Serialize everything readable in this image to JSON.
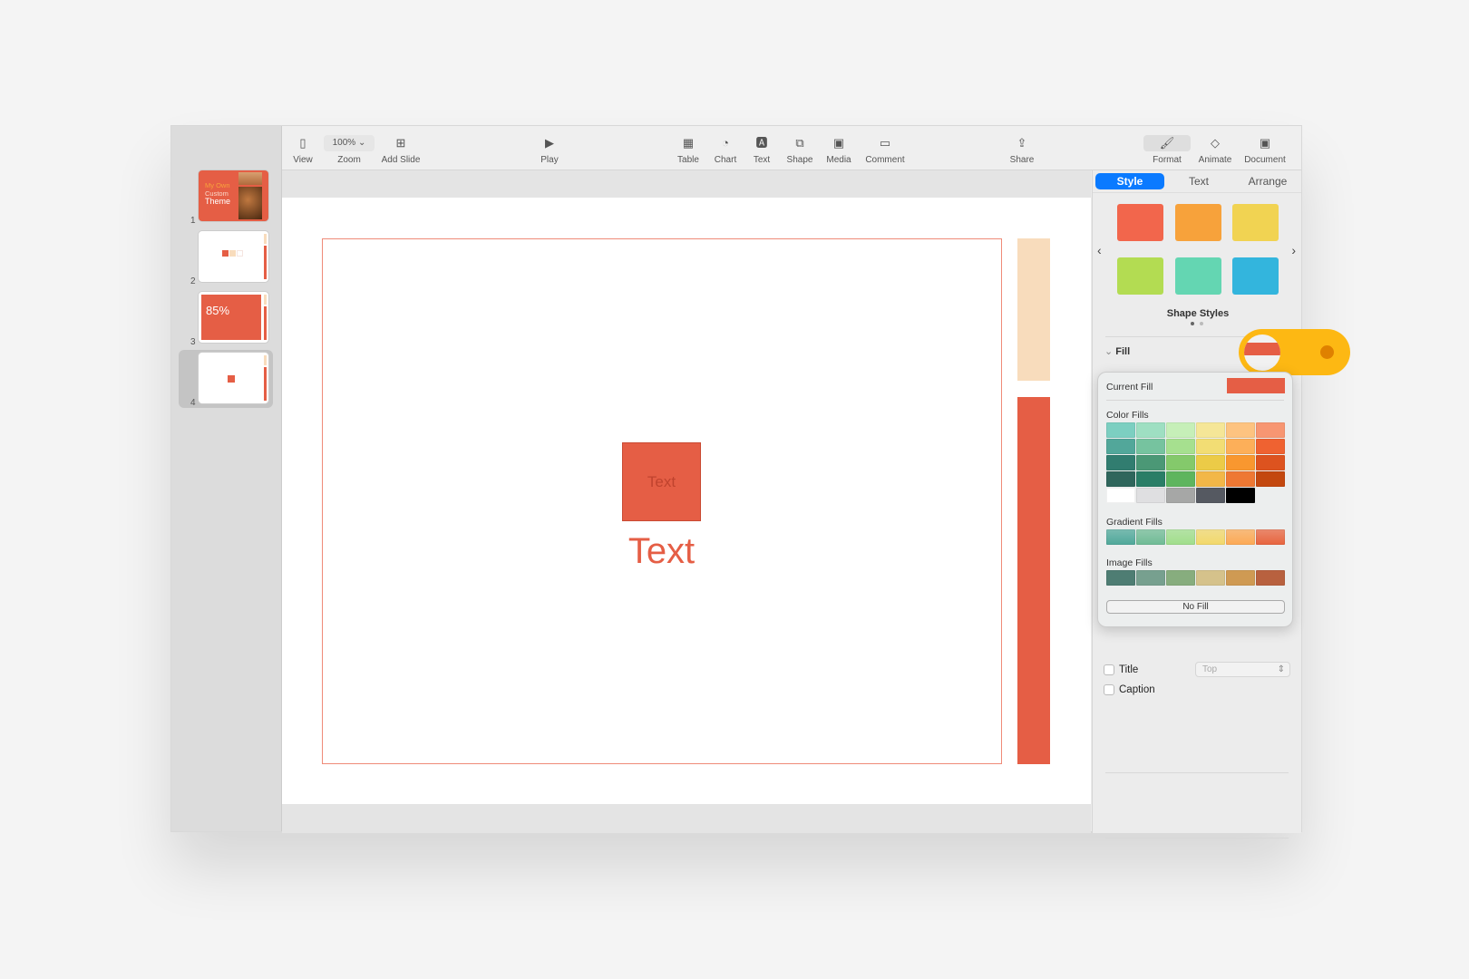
{
  "toolbar": {
    "view": "View",
    "zoom_value": "100%",
    "zoom": "Zoom",
    "add_slide": "Add Slide",
    "play": "Play",
    "table": "Table",
    "chart": "Chart",
    "text": "Text",
    "shape": "Shape",
    "media": "Media",
    "comment": "Comment",
    "share": "Share",
    "format": "Format",
    "animate": "Animate",
    "document": "Document"
  },
  "slides": [
    {
      "num": "1",
      "title_orange": "My Own",
      "title_a": "Custom",
      "title_b": "Theme"
    },
    {
      "num": "2"
    },
    {
      "num": "3",
      "big": "85%"
    },
    {
      "num": "4"
    }
  ],
  "slide": {
    "shape_text": "Text",
    "caption_text": "Text"
  },
  "panel": {
    "tabs": [
      "Style",
      "Text",
      "Arrange"
    ],
    "shape_styles": "Shape Styles",
    "fill": "Fill",
    "title": "Title",
    "caption": "Caption",
    "title_position": "Top"
  },
  "popover": {
    "current_fill": "Current Fill",
    "color_fills": "Color Fills",
    "gradient_fills": "Gradient Fills",
    "image_fills": "Image Fills",
    "no_fill": "No Fill"
  },
  "colors": {
    "accent": "#0a7aff",
    "theme_red": "#e55e45",
    "peach": "#f8dcbc",
    "highlight": "#fdb813",
    "shape_styles": [
      "#f2664c",
      "#f7a23b",
      "#f1d352",
      "#b3dc52",
      "#64d6b2",
      "#33b5dd"
    ],
    "color_fills": [
      "#7ccfc1",
      "#9edfc2",
      "#c6efb8",
      "#f5e697",
      "#fdc380",
      "#f79672",
      "#52a79a",
      "#76c39f",
      "#a6e08f",
      "#f2dd74",
      "#fdaf59",
      "#ef6231",
      "#317d70",
      "#4b9876",
      "#84c96b",
      "#eccb47",
      "#f9972f",
      "#dd531f",
      "#2f665c",
      "#2a7e67",
      "#5eb55e",
      "#f2b748",
      "#ee7833",
      "#c3480f",
      "#ffffff",
      "#dfdfe1",
      "#a6a7a6",
      "#555961",
      "#000000"
    ],
    "gradient_fills": [
      "#4fa89a",
      "#6fbb95",
      "#a0de8b",
      "#f2d86a",
      "#fca954",
      "#e8643e"
    ],
    "image_fills": [
      "#4e7d73",
      "#77a08f",
      "#87ad7e",
      "#d5c28b",
      "#cf9a53",
      "#b8613f"
    ]
  }
}
